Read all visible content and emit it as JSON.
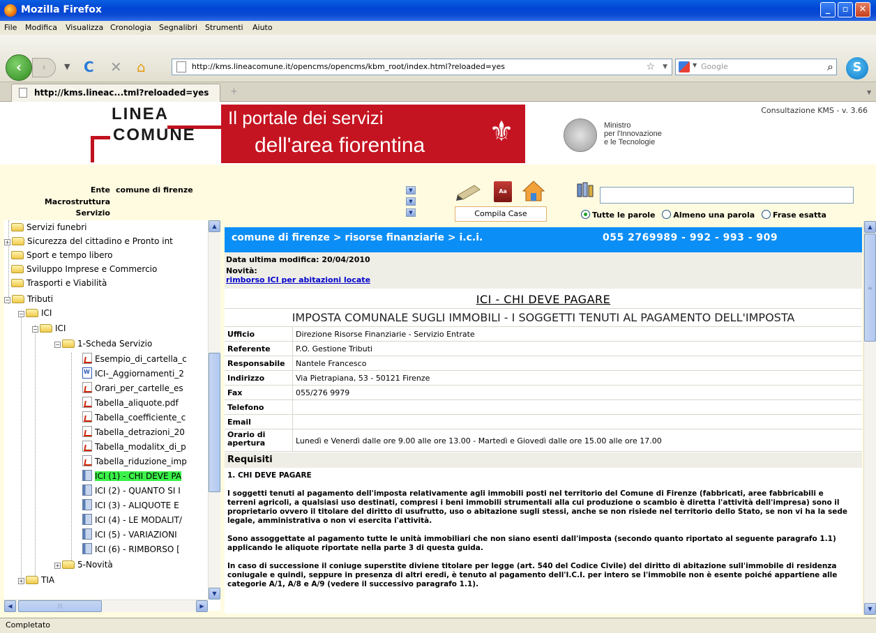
{
  "window": {
    "title": "Mozilla Firefox"
  },
  "menu": [
    "File",
    "Modifica",
    "Visualizza",
    "Cronologia",
    "Segnalibri",
    "Strumenti",
    "Aiuto"
  ],
  "nav": {
    "url": "http://kms.lineacomune.it/opencms/opencms/kbm_root/index.html?reloaded=yes",
    "search_placeholder": "Google"
  },
  "tab": {
    "label": "http://kms.lineac...tml?reloaded=yes"
  },
  "header": {
    "logo_line1": "LINEA",
    "logo_line2": "COMUNE",
    "banner_line1": "Il portale dei servizi",
    "banner_line2": "dell'area fiorentina",
    "ministro_line1": "Ministro",
    "ministro_line2": "per l'Innovazione",
    "ministro_line3": "e le Tecnologie",
    "version": "Consultazione KMS - v. 3.66"
  },
  "filters": {
    "ente_label": "Ente",
    "ente_value": "comune di firenze",
    "macro_label": "Macrostruttura",
    "servizio_label": "Servizio",
    "case_button": "Compila Case",
    "book_label": "Aa",
    "radio": [
      "Tutte le parole",
      "Almeno una parola",
      "Frase esatta"
    ]
  },
  "tree": [
    "Servizi funebri",
    "Sicurezza del cittadino e Pronto int",
    "Sport e tempo libero",
    "Sviluppo Imprese e Commercio",
    "Trasporti e Viabilità",
    "Tributi",
    "ICI",
    "ICI",
    "1-Scheda Servizio",
    "Esempio_di_cartella_c",
    "ICI-_Aggiornamenti_2",
    "Orari_per_cartelle_es",
    "Tabella_aliquote.pdf",
    "Tabella_coefficiente_c",
    "Tabella_detrazioni_20",
    "Tabella_modalitx_di_p",
    "Tabella_riduzione_imp",
    "ICI (1) - CHI DEVE PA",
    "ICI (2) - QUANTO SI I",
    "ICI (3) - ALIQUOTE E",
    "ICI (4) - LE MODALIT/",
    "ICI (5) - VARIAZIONI",
    "ICI (6) - RIMBORSO [",
    "5-Novità",
    "TIA"
  ],
  "content": {
    "breadcrumb": "comune di firenze > risorse finanziarie > i.c.i.",
    "phone": "055 2769989 - 992 - 993 - 909",
    "last_modified": "Data ultima modifica: 20/04/2010",
    "news_label": "Novità:",
    "news_link": "rimborso ICI per abitazioni locate",
    "title": "ICI - CHI DEVE PAGARE",
    "subtitle": "IMPOSTA COMUNALE SUGLI IMMOBILI - I SOGGETTI TENUTI AL PAGAMENTO DELL'IMPOSTA",
    "fields": [
      {
        "k": "Ufficio",
        "v": "Direzione Risorse Finanziarie - Servizio Entrate"
      },
      {
        "k": "Referente",
        "v": "P.O. Gestione Tributi"
      },
      {
        "k": "Responsabile",
        "v": "Nantele Francesco"
      },
      {
        "k": "Indirizzo",
        "v": "Via Pietrapiana, 53 - 50121 Firenze"
      },
      {
        "k": "Fax",
        "v": "055/276 9979"
      },
      {
        "k": "Telefono",
        "v": ""
      },
      {
        "k": "Email",
        "v": ""
      }
    ],
    "orario_k1": "Orario di",
    "orario_k2": "apertura",
    "orario_v": "Lunedì e Venerdì dalle ore 9.00 alle ore 13.00 - Martedì e Giovedì dalle ore 15.00 alle ore 17.00",
    "req_head": "Requisiti",
    "req_p0": "1. CHI DEVE PAGARE",
    "req_p1": "I soggetti tenuti al pagamento dell'imposta relativamente agli immobili posti nel territorio del Comune di Firenze (fabbricati, aree fabbricabili e terreni agricoli, a qualsiasi uso destinati, compresi i beni immobili strumentali alla cui produzione o scambio è diretta l'attività dell'impresa) sono il proprietario ovvero il titolare del diritto di usufrutto, uso o abitazione sugli stessi, anche se non risiede nel territorio dello Stato, se non vi ha la sede legale, amministrativa o non vi esercita l'attività.",
    "req_p2": "Sono assoggettate al pagamento tutte le unità immobiliari che non siano esenti dall'imposta (secondo quanto riportato al seguente paragrafo 1.1) applicando le aliquote riportate nella parte 3 di questa guida.",
    "req_p3": "In caso di successione il coniuge superstite diviene titolare per legge (art. 540 del Codice Civile) del diritto di abitazione sull'immobile di residenza coniugale e quindi, seppure in presenza di altri eredi, è tenuto al pagamento dell'I.C.I. per intero se l'immobile non è esente poiché appartiene alle categorie A/1, A/8 e A/9 (vedere il successivo paragrafo 1.1)."
  },
  "status": "Completato"
}
